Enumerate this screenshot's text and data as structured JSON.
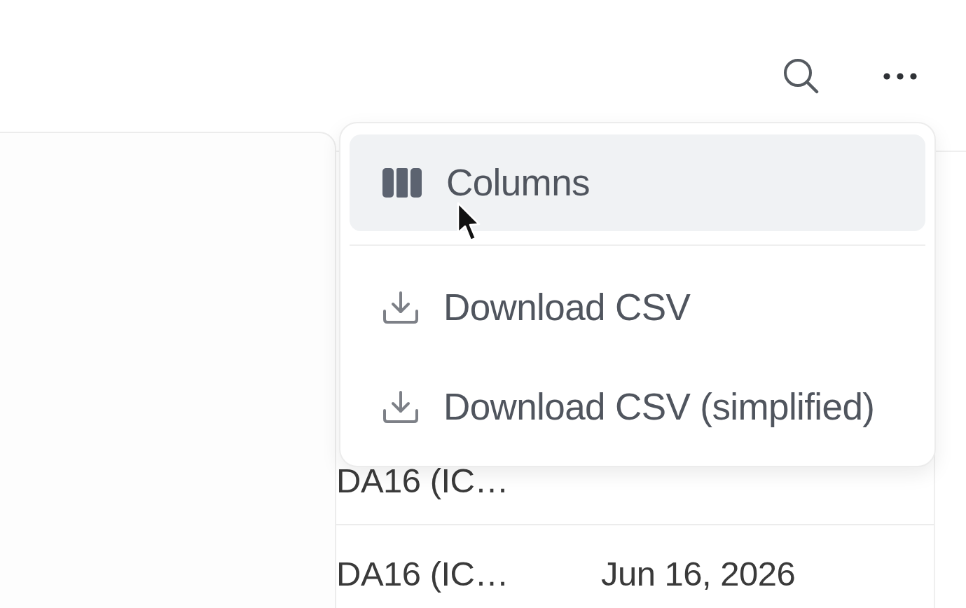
{
  "menu": {
    "groups": [
      [
        {
          "kind": "columns",
          "label": "Columns",
          "highlighted": true
        }
      ],
      [
        {
          "kind": "download",
          "label": "Download CSV",
          "highlighted": false
        },
        {
          "kind": "download",
          "label": "Download CSV (simplified)",
          "highlighted": false
        }
      ]
    ]
  },
  "table": {
    "rows": [
      {
        "column_1": "DA16 (IC…"
      },
      {
        "column_1": "DA16 (IC…",
        "column_2": "Jun 16, 2026"
      }
    ]
  }
}
